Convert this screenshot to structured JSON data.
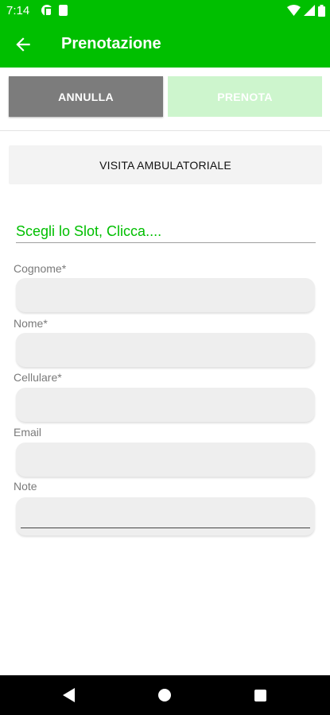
{
  "status_bar": {
    "time": "7:14",
    "icons": [
      "app-notification-icon",
      "sd-card-icon",
      "wifi-icon",
      "signal-icon",
      "battery-icon"
    ]
  },
  "app_bar": {
    "title": "Prenotazione",
    "back_icon": "arrow-left-icon"
  },
  "actions": {
    "cancel_label": "ANNULLA",
    "book_label": "PRENOTA"
  },
  "service": {
    "label": "VISITA AMBULATORIALE"
  },
  "slot": {
    "label": "Scegli lo Slot, Clicca...."
  },
  "form": {
    "surname_label": "Cognome*",
    "surname_value": "",
    "name_label": "Nome*",
    "name_value": "",
    "phone_label": "Cellulare*",
    "phone_value": "",
    "email_label": "Email",
    "email_value": "",
    "notes_label": "Note",
    "notes_value": ""
  },
  "nav_bar": {
    "icons": [
      "nav-back-icon",
      "nav-home-icon",
      "nav-recents-icon"
    ]
  },
  "colors": {
    "primary": "#00bf00",
    "cancel_button": "#7c7c7c",
    "book_button_disabled": "#cdf5cd",
    "input_background": "#eeeeee"
  }
}
